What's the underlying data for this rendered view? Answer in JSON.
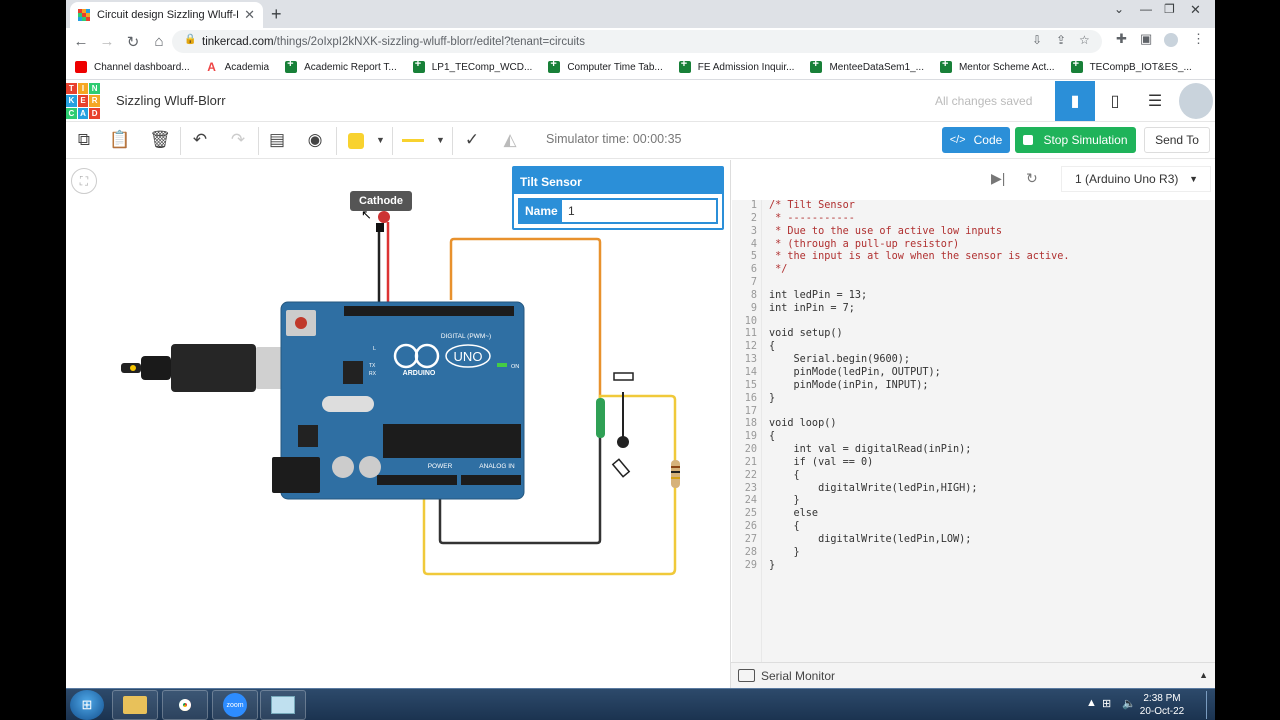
{
  "browser": {
    "tab_title": "Circuit design Sizzling Wluff-Blorr",
    "url_host": "tinkercad.com",
    "url_path": "/things/2oIxpI2kNXK-sizzling-wluff-blorr/editel?tenant=circuits",
    "bookmarks": [
      "Channel dashboard...",
      "Academia",
      "Academic Report T...",
      "LP1_TEComp_WCD...",
      "Computer Time Tab...",
      "FE Admission Inquir...",
      "MenteeDataSem1_...",
      "Mentor Scheme Act...",
      "TECompB_IOT&ES_..."
    ]
  },
  "app": {
    "logo_letters": [
      "T",
      "I",
      "N",
      "K",
      "E",
      "R",
      "C",
      "A",
      "D"
    ],
    "project_name": "Sizzling Wluff-Blorr",
    "save_status": "All changes saved"
  },
  "toolbar": {
    "sim_time": "Simulator time: 00:00:35",
    "code_label": "Code",
    "stop_label": "Stop Simulation",
    "send_label": "Send To"
  },
  "canvas": {
    "tooltip": "Cathode",
    "board_labels": {
      "uno": "UNO",
      "arduino": "ARDUINO",
      "digital": "DIGITAL (PWM~)",
      "power": "POWER",
      "analog": "ANALOG IN",
      "on": "ON",
      "l": "L",
      "tx": "TX",
      "rx": "RX"
    }
  },
  "inspector": {
    "title": "Tilt Sensor",
    "name_label": "Name",
    "name_value": "1"
  },
  "codepanel": {
    "device": "1 (Arduino Uno R3)",
    "serial_label": "Serial Monitor",
    "lines": [
      "/* Tilt Sensor",
      " * -----------",
      " * Due to the use of active low inputs",
      " * (through a pull-up resistor)",
      " * the input is at low when the sensor is active.",
      " */",
      "",
      "int ledPin = 13;",
      "int inPin = 7;",
      "",
      "void setup()",
      "{",
      "    Serial.begin(9600);",
      "    pinMode(ledPin, OUTPUT);",
      "    pinMode(inPin, INPUT);",
      "}",
      "",
      "void loop()",
      "{",
      "    int val = digitalRead(inPin);",
      "    if (val == 0)",
      "    {",
      "        digitalWrite(ledPin,HIGH);",
      "    }",
      "    else",
      "    {",
      "        digitalWrite(ledPin,LOW);",
      "    }",
      "}"
    ]
  },
  "taskbar": {
    "time": "2:38 PM",
    "date": "20-Oct-22",
    "zoom_label": "zoom"
  },
  "colors": {
    "accent": "#2b8fd8",
    "stop": "#1fb35a",
    "board": "#2f6fa3",
    "wire_orange": "#e8912d",
    "wire_yellow": "#f0c93a"
  }
}
